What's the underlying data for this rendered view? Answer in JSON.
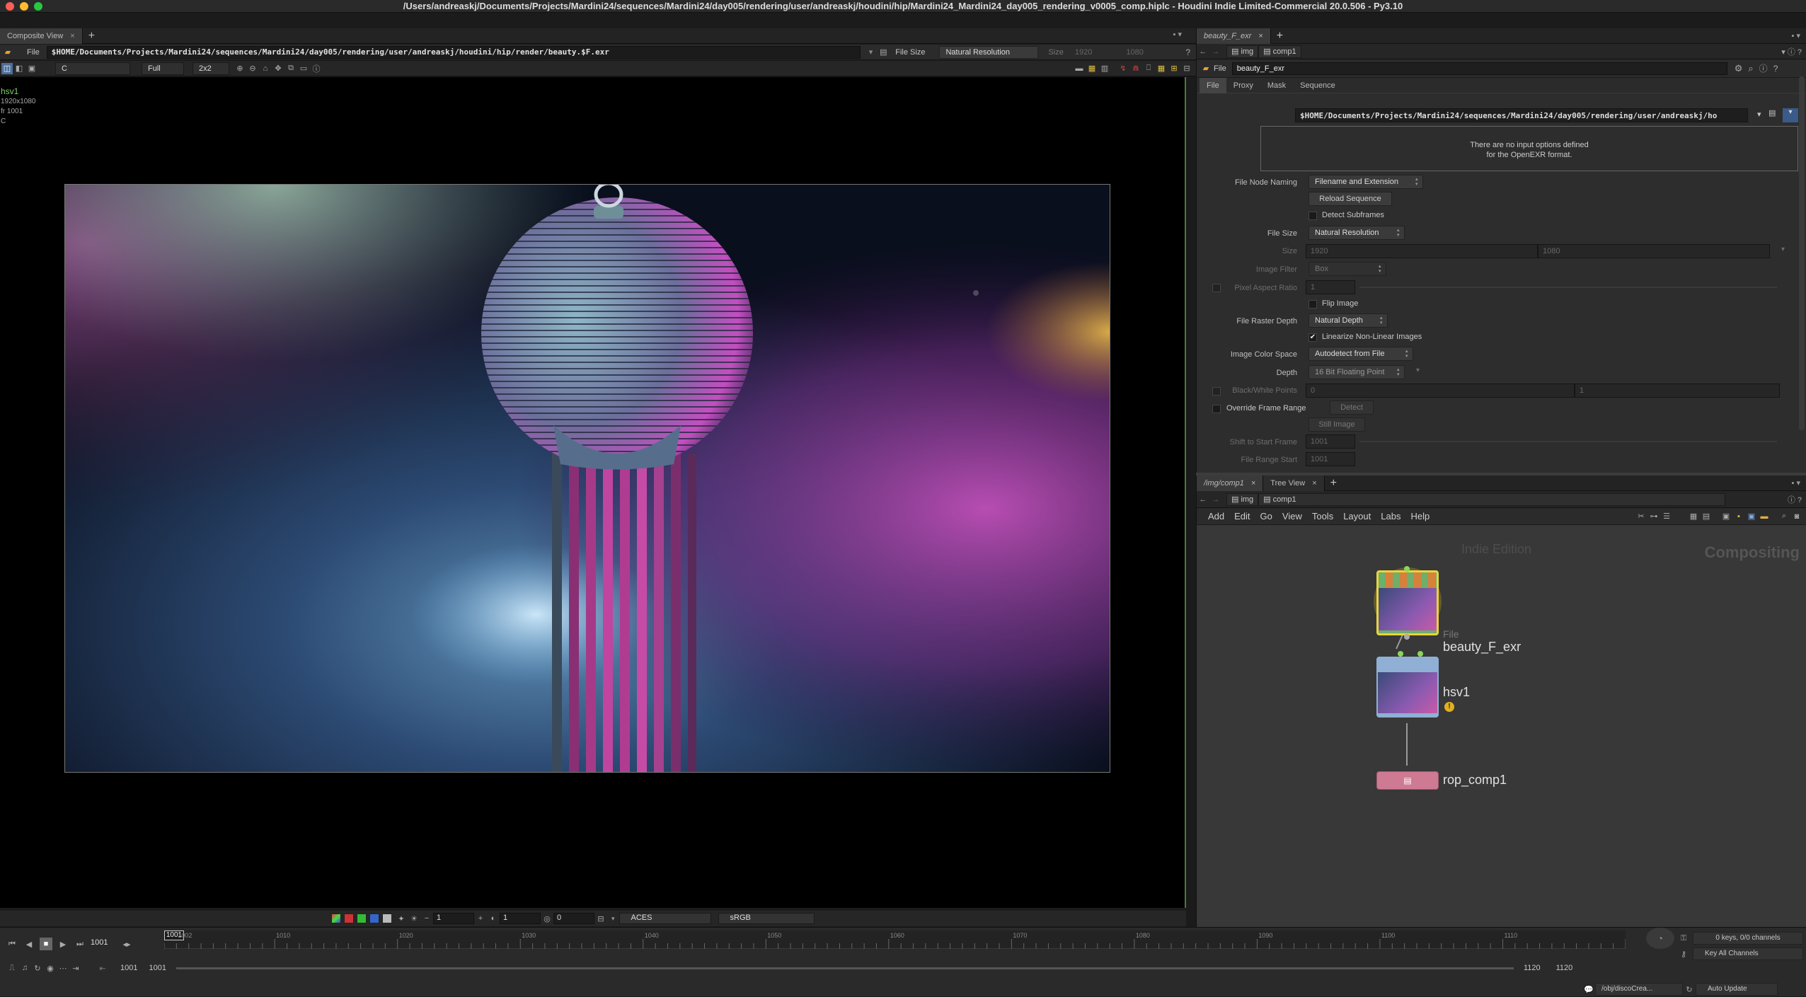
{
  "window": {
    "title": "/Users/andreaskj/Documents/Projects/Mardini24/sequences/Mardini24/day005/rendering/user/andreaskj/houdini/hip/Mardini24_Mardini24_day005_rendering_v0005_comp.hiplc - Houdini Indie Limited-Commercial 20.0.506 - Py3.10"
  },
  "viewer": {
    "tab_label": "Composite View",
    "file_menu": "File",
    "file_path": "$HOME/Documents/Projects/Mardini24/sequences/Mardini24/day005/rendering/user/andreaskj/houdini/hip/render/beauty.$F.exr",
    "file_size_label": "File Size",
    "file_size_value": "Natural Resolution",
    "size_label": "Size",
    "size_w": "1920",
    "size_h": "1080",
    "plane": "C",
    "resolution": "Full",
    "tiling": "2x2",
    "info_node": "hsv1",
    "info_res": "1920x1080",
    "info_frame": "fr 1001",
    "info_channel": "C",
    "bottom_val1": "1",
    "bottom_val2": "1",
    "bottom_val3": "0",
    "display_lut": "ACES",
    "view_lut": "sRGB"
  },
  "timeline": {
    "current_frame": "1001",
    "range_start": "1001",
    "range_start2": "1001",
    "range_end": "1120",
    "range_end2": "1120",
    "keys_info": "0 keys, 0/0 channels",
    "key_all": "Key All Channels",
    "obj_path": "/obj/discoCrea...",
    "auto_update": "Auto Update",
    "ruler_ticks": [
      "1002",
      "1010",
      "1020",
      "1030",
      "1040",
      "1050",
      "1060",
      "1070",
      "1080",
      "1090",
      "1100",
      "1110"
    ],
    "marker": "1001"
  },
  "params": {
    "tab_label": "beauty_F_exr",
    "path_img": "img",
    "path_comp": "comp1",
    "node_type": "File",
    "node_name": "beauty_F_exr",
    "tabs": [
      "File",
      "Proxy",
      "Mask",
      "Sequence"
    ],
    "file_label": "File",
    "file_value": "$HOME/Documents/Projects/Mardini24/sequences/Mardini24/day005/rendering/user/andreaskj/ho",
    "info_line1": "There are no input options defined",
    "info_line2": "for the OpenEXR format.",
    "file_node_naming_label": "File Node Naming",
    "file_node_naming": "Filename and Extension",
    "reload_sequence": "Reload Sequence",
    "detect_subframes": "Detect Subframes",
    "file_size_label": "File Size",
    "file_size": "Natural Resolution",
    "size_label": "Size",
    "size_w": "1920",
    "size_h": "1080",
    "image_filter_label": "Image Filter",
    "image_filter": "Box",
    "pixel_aspect_label": "Pixel Aspect Ratio",
    "pixel_aspect": "1",
    "flip_image": "Flip Image",
    "raster_depth_label": "File Raster Depth",
    "raster_depth": "Natural Depth",
    "linearize": "Linearize Non-Linear Images",
    "color_space_label": "Image Color Space",
    "color_space": "Autodetect from File",
    "depth_label": "Depth",
    "depth": "16 Bit Floating Point",
    "bw_points_label": "Black/White Points",
    "bw_black": "0",
    "bw_white": "1",
    "override_range": "Override Frame Range",
    "detect": "Detect",
    "still_image": "Still Image",
    "shift_start_label": "Shift to Start Frame",
    "shift_start": "1001",
    "range_start_label": "File Range Start",
    "range_start": "1001"
  },
  "network": {
    "tab_label": "/img/comp1",
    "tree_view": "Tree View",
    "path_img": "img",
    "path_comp": "comp1",
    "menu": [
      "Add",
      "Edit",
      "Go",
      "View",
      "Tools",
      "Layout",
      "Labs",
      "Help"
    ],
    "watermark_edition": "Indie Edition",
    "watermark_context": "Compositing",
    "nodes": [
      {
        "type": "File",
        "name": "beauty_F_exr"
      },
      {
        "type": "",
        "name": "hsv1"
      },
      {
        "type": "",
        "name": "rop_comp1"
      }
    ]
  },
  "colors": {
    "accent_yellow": "#e8d43a",
    "node_green": "#6fae6b",
    "node_blue": "#8fb0d4",
    "node_pink": "#cf7a93"
  }
}
